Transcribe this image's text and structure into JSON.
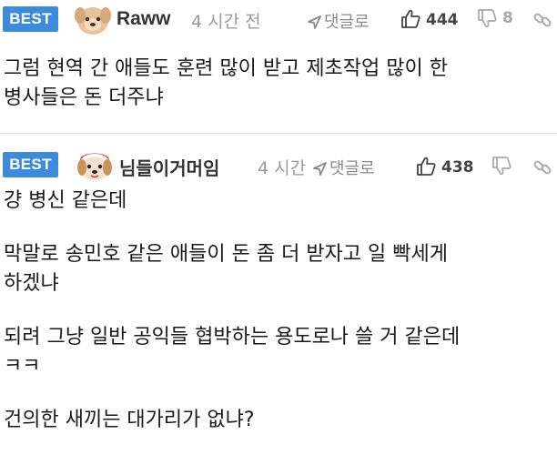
{
  "comments": [
    {
      "badge": "BEST",
      "nickname": "Raww",
      "time": "4 시간 전",
      "reply_label": "댓글로",
      "likes": "444",
      "dislikes": "8",
      "lines": [
        "그럼 현역 간 애들도 훈련 많이 받고 제초작업 많이 한",
        "병사들은 돈 더주냐"
      ]
    },
    {
      "badge": "BEST",
      "nickname": "님들이거머임",
      "time": "4 시간",
      "reply_label": "댓글로",
      "likes": "438",
      "dislikes": "",
      "paragraphs": [
        [
          "걍 병신 같은데"
        ],
        [
          "막말로 송민호 같은 애들이 돈 좀 더 받자고 일 빡세게",
          "하겠냐"
        ],
        [
          "되려 그냥 일반 공익들 협박하는 용도로나 쓸 거 같은데",
          "ㅋㅋ"
        ],
        [
          "건의한 새끼는 대가리가 없냐?"
        ]
      ]
    }
  ],
  "colors": {
    "badge": "#3d8bdc",
    "muted": "#9a9a9a",
    "text": "#1a1a1a"
  }
}
